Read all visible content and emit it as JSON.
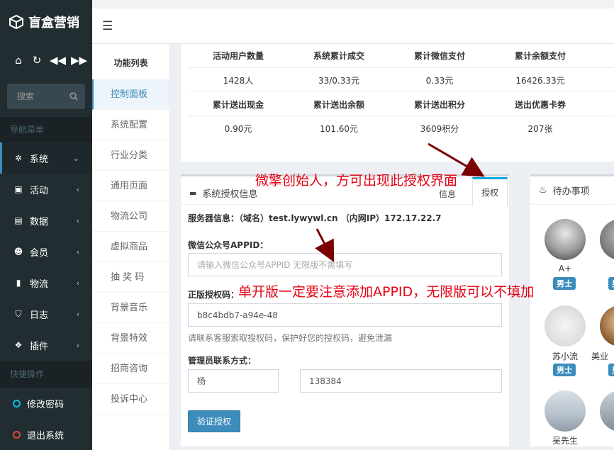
{
  "app": {
    "logo_text": "盲盒营销"
  },
  "search": {
    "placeholder": "搜索"
  },
  "sidebar": {
    "nav_header": "导航菜单",
    "items": [
      {
        "label": "系统",
        "icon": "gear-icon"
      },
      {
        "label": "活动",
        "icon": "gift-icon"
      },
      {
        "label": "数据",
        "icon": "briefcase-icon"
      },
      {
        "label": "会员",
        "icon": "users-icon"
      },
      {
        "label": "物流",
        "icon": "bookmark-icon"
      },
      {
        "label": "日志",
        "icon": "shield-icon"
      },
      {
        "label": "插件",
        "icon": "cubes-icon"
      }
    ],
    "quick_header": "快捷操作",
    "quick_items": [
      {
        "label": "修改密码",
        "color": "#00c0ef"
      },
      {
        "label": "退出系统",
        "color": "#dd4b39"
      }
    ]
  },
  "subnav": {
    "title": "功能列表",
    "items": [
      "控制面板",
      "系统配置",
      "行业分类",
      "通用页面",
      "物流公司",
      "虚拟商品",
      "抽 奖 码",
      "背景音乐",
      "背景特效",
      "招商咨询",
      "投诉中心"
    ]
  },
  "stats": {
    "row1_headers": [
      "活动用户数量",
      "系统累计成交",
      "累计微信支付",
      "累计余额支付"
    ],
    "row1_values": [
      "1428人",
      "33/0.33元",
      "0.33元",
      "16426.33元"
    ],
    "row2_headers": [
      "累计送出现金",
      "累计送出余额",
      "累计送出积分",
      "送出优惠卡券"
    ],
    "row2_values": [
      "0.90元",
      "101.60元",
      "3609积分",
      "207张"
    ]
  },
  "auth": {
    "title": "系统授权信息",
    "tab_info": "信息",
    "tab_auth": "授权",
    "server_info": "服务器信息：（域名）test.lywywl.cn （内网IP）172.17.22.7",
    "appid_label": "微信公众号APPID：",
    "appid_placeholder": "请输入微信公众号APPID 无限版不需填写",
    "license_label": "正版授权码：",
    "license_value": "b8c4bdb7-a94e-48",
    "license_help": "请联系客服索取授权码，保护好您的授权码，避免泄漏",
    "contact_label": "管理员联系方式：",
    "contact_name": "杨",
    "contact_phone": "138384",
    "verify_button": "验证授权"
  },
  "todo": {
    "title": "待办事项",
    "users": [
      {
        "name": "A+",
        "badge": "男士"
      },
      {
        "name": "苏小流",
        "badge": "男士"
      },
      {
        "name": "美业",
        "badge": "男士"
      },
      {
        "name": "吴先生"
      }
    ]
  },
  "annotations": {
    "note1": "微擎创始人，方可出现此授权界面",
    "note2": "单开版一定要注意添加APPID，无限版可以不填加"
  }
}
